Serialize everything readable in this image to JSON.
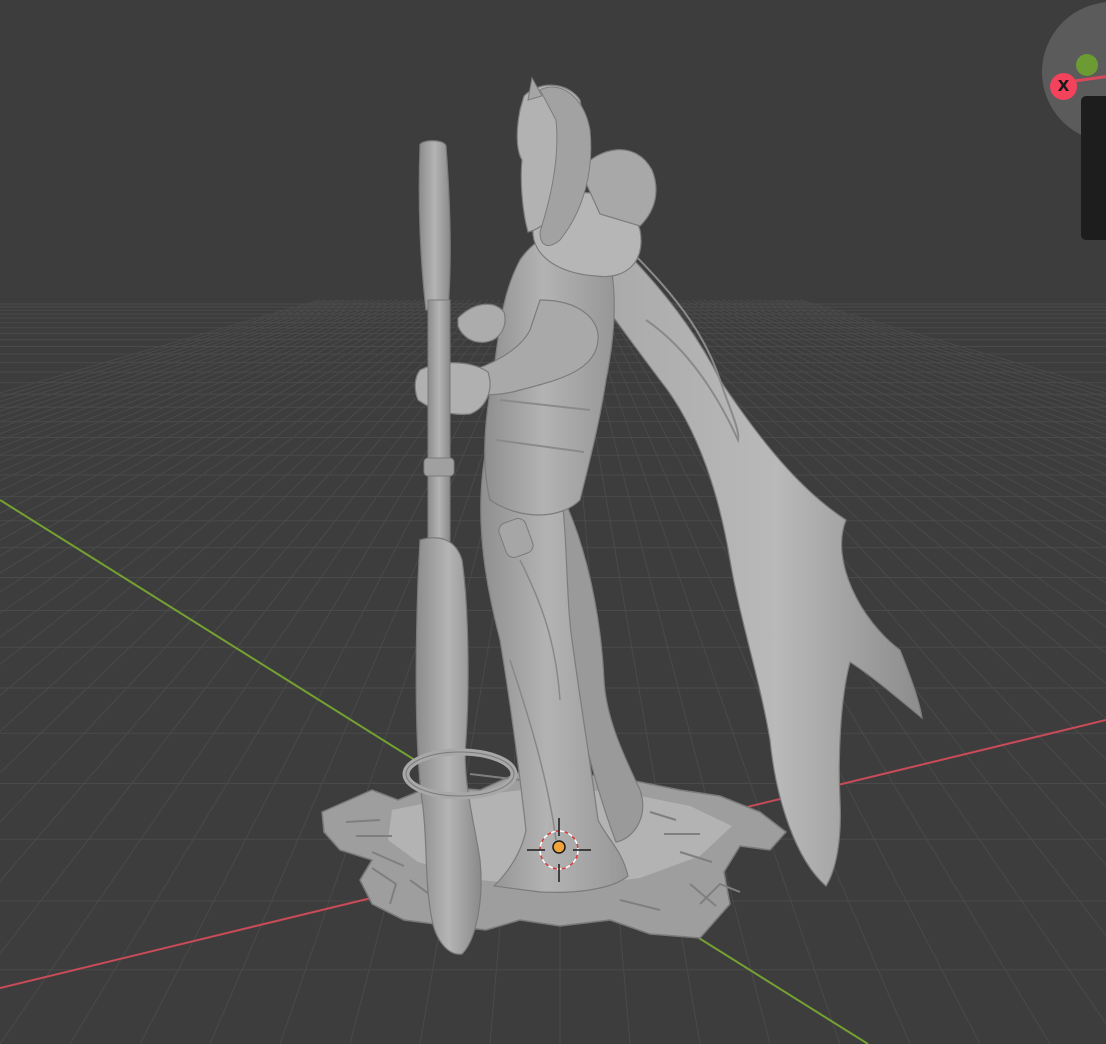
{
  "viewport": {
    "background": "#3d3d3d",
    "grid_color": "#4a4a4a",
    "x_axis_color": "#c84b57",
    "y_axis_color": "#74a132"
  },
  "object": {
    "kind": "sculpt-mesh",
    "color": "#a8a8a8"
  },
  "origin": {
    "icon": "object-origin-icon",
    "color": "#f2a33a"
  },
  "gizmo": {
    "x_label": "X",
    "x_color": "#f3425b",
    "y_color": "#6c9b33"
  }
}
